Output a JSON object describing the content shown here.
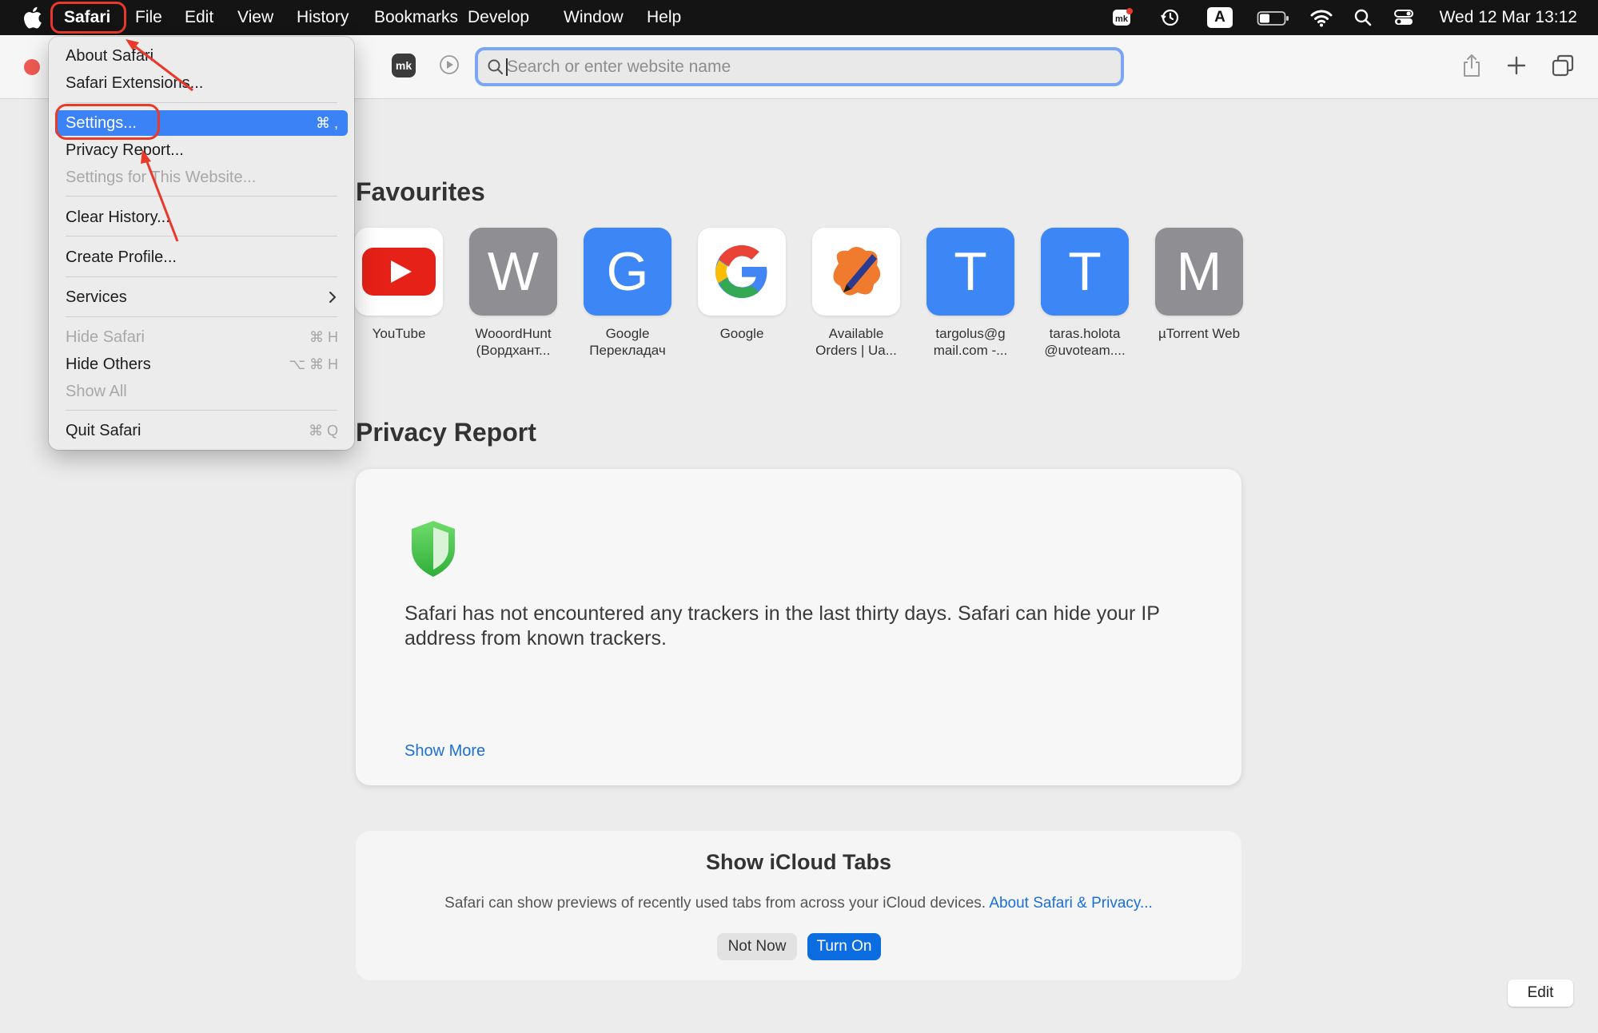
{
  "menubar": {
    "app_name": "Safari",
    "items": [
      "File",
      "Edit",
      "View",
      "History",
      "Bookmarks",
      "Develop",
      "Window",
      "Help"
    ],
    "input_source": "A",
    "clock": "Wed 12 Mar  13:12"
  },
  "toolbar": {
    "extension_label": "mk",
    "address_placeholder": "Search or enter website name",
    "address_value": ""
  },
  "safari_menu": {
    "about": "About Safari",
    "extensions": "Safari Extensions...",
    "settings": {
      "label": "Settings...",
      "shortcut": "⌘ ,"
    },
    "privacy_report": "Privacy Report...",
    "settings_website": "Settings for This Website...",
    "clear_history": "Clear History...",
    "create_profile": "Create Profile...",
    "services": "Services",
    "hide_safari": {
      "label": "Hide Safari",
      "shortcut": "⌘ H"
    },
    "hide_others": {
      "label": "Hide Others",
      "shortcut": "⌥ ⌘ H"
    },
    "show_all": "Show All",
    "quit": {
      "label": "Quit Safari",
      "shortcut": "⌘ Q"
    }
  },
  "favourites": {
    "title": "Favourites",
    "items": [
      {
        "label": "YouTube",
        "letter": "",
        "color": "#ffffff",
        "icon": "youtube-icon"
      },
      {
        "label": "WooordHunt (Вордхант...",
        "letter": "W",
        "color": "#8e8e93"
      },
      {
        "label": "Google Перекладач",
        "letter": "G",
        "color": "#3d86f6"
      },
      {
        "label": "Google",
        "letter": "",
        "color": "#ffffff",
        "icon": "google-icon"
      },
      {
        "label": "Available Orders | Ua...",
        "letter": "",
        "color": "#ffffff",
        "icon": "pen-splash-icon"
      },
      {
        "label": "targolus@g mail.com -...",
        "letter": "T",
        "color": "#3d86f6"
      },
      {
        "label": "taras.holota @uvoteam....",
        "letter": "T",
        "color": "#3d86f6"
      },
      {
        "label": "µTorrent Web",
        "letter": "M",
        "color": "#8e8e93"
      }
    ]
  },
  "privacy": {
    "title": "Privacy Report",
    "description": "Safari has not encountered any trackers in the last thirty days. Safari can hide your IP address from known trackers.",
    "show_more": "Show More"
  },
  "icloud": {
    "title": "Show iCloud Tabs",
    "text": "Safari can show previews of recently used tabs from across your iCloud devices.",
    "link": "About Safari & Privacy...",
    "not_now": "Not Now",
    "turn_on": "Turn On"
  },
  "edit_label": "Edit"
}
